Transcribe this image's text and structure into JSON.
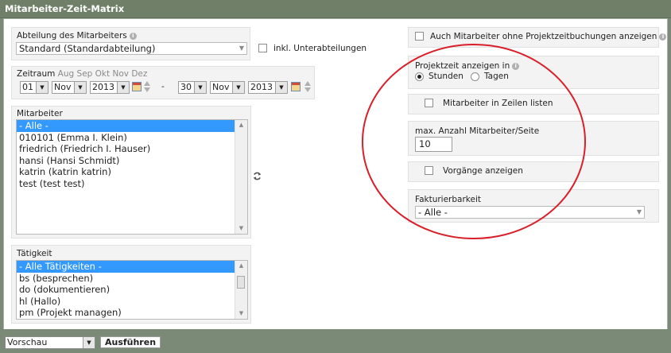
{
  "window": {
    "title": "Mitarbeiter-Zeit-Matrix"
  },
  "abteilung": {
    "label": "Abteilung des Mitarbeiters",
    "value": "Standard (Standardabteilung)",
    "sub_label": "inkl. Unterabteilungen",
    "sub_checked": false
  },
  "zeitraum": {
    "label": "Zeitraum",
    "months": [
      "Aug",
      "Sep",
      "Okt",
      "Nov",
      "Dez"
    ],
    "from": {
      "day": "01",
      "month": "Nov",
      "year": "2013"
    },
    "separator": "-",
    "to": {
      "day": "30",
      "month": "Nov",
      "year": "2013"
    }
  },
  "mitarbeiter": {
    "label": "Mitarbeiter",
    "items": [
      "- Alle -",
      "010101 (Emma I. Klein)",
      "friedrich (Friedrich I. Hauser)",
      "hansi (Hansi Schmidt)",
      "katrin (katrin katrin)",
      "test (test test)"
    ],
    "selected_index": 0,
    "refresh_icon": "refresh-icon"
  },
  "taetigkeit": {
    "label": "Tätigkeit",
    "items": [
      "- Alle Tätigkeiten -",
      "bs (besprechen)",
      "do (dokumentieren)",
      "hl (Hallo)",
      "pm (Projekt managen)"
    ],
    "selected_index": 0
  },
  "options": {
    "ohne_projekt_label": "Auch Mitarbeiter ohne Projektzeitbuchungen anzeigen",
    "projektzeit_label": "Projektzeit anzeigen in",
    "stunden_label": "Stunden",
    "tagen_label": "Tagen",
    "unit_selected": "Stunden",
    "zeilen_label": "Mitarbeiter in Zeilen listen",
    "max_label": "max. Anzahl Mitarbeiter/Seite",
    "max_value": "10",
    "vorgaenge_label": "Vorgänge anzeigen",
    "faktur_label": "Fakturierbarkeit",
    "faktur_value": "- Alle -"
  },
  "footer": {
    "output_value": "Vorschau",
    "run_label": "Ausführen"
  },
  "colors": {
    "accent_selection": "#3399ff",
    "annotation_circle": "#d9202a",
    "titlebar": "#6f7f68"
  }
}
